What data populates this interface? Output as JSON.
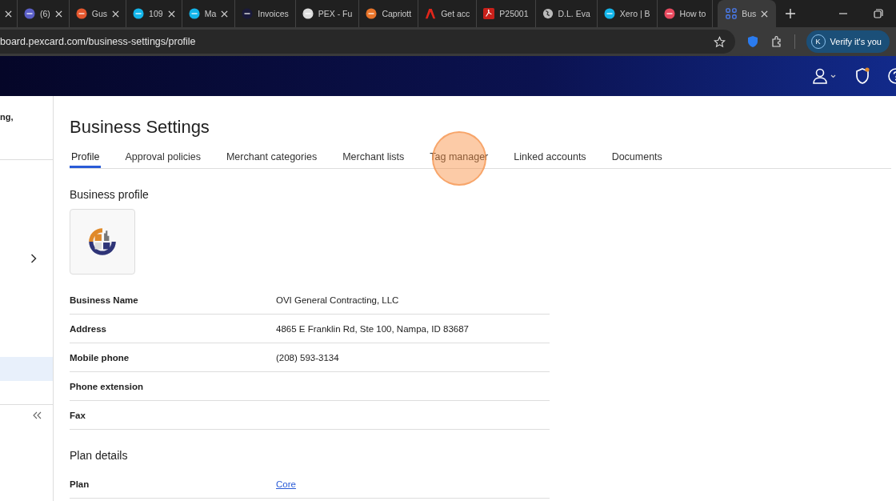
{
  "browser": {
    "tabs": [
      {
        "selected": false
      },
      {
        "title": "(6)",
        "selected": false
      },
      {
        "title": "Gus",
        "selected": false
      },
      {
        "title": "109",
        "selected": false
      },
      {
        "title": "Ma",
        "selected": false
      },
      {
        "title": "Invoices",
        "selected": false
      },
      {
        "title": "PEX - Fu",
        "selected": false
      },
      {
        "title": "Capriott",
        "selected": false
      },
      {
        "title": "Get acc",
        "selected": false
      },
      {
        "title": "P25001",
        "selected": false
      },
      {
        "title": "D.L. Eva",
        "selected": false
      },
      {
        "title": "Xero | B",
        "selected": false
      },
      {
        "title": "How to",
        "selected": false
      },
      {
        "title": "Bus",
        "selected": true
      }
    ],
    "url": "board.pexcard.com/business-settings/profile",
    "profile_button": {
      "initial": "K",
      "label": "Verify it's you"
    }
  },
  "sidebar": {
    "text": "ng,",
    "selected_row": true
  },
  "page": {
    "title": "Business Settings",
    "tabs": [
      {
        "label": "Profile",
        "selected": true,
        "highlighted": false
      },
      {
        "label": "Approval policies",
        "selected": false,
        "highlighted": false
      },
      {
        "label": "Merchant categories",
        "selected": false,
        "highlighted": false
      },
      {
        "label": "Merchant lists",
        "selected": false,
        "highlighted": false
      },
      {
        "label": "Tag manager",
        "selected": false,
        "highlighted": true
      },
      {
        "label": "Linked accounts",
        "selected": false,
        "highlighted": false
      },
      {
        "label": "Documents",
        "selected": false,
        "highlighted": false
      }
    ],
    "sections": [
      {
        "heading": "Business profile",
        "logo": true,
        "rows": [
          {
            "label": "Business Name",
            "value": "OVI General Contracting, LLC",
            "kind": "text"
          },
          {
            "label": "Address",
            "value": "4865 E Franklin Rd, Ste 100, Nampa, ID 83687",
            "kind": "text"
          },
          {
            "label": "Mobile phone",
            "value": "(208) 593-3134",
            "kind": "text"
          },
          {
            "label": "Phone extension",
            "kind": "text"
          },
          {
            "label": "Fax",
            "kind": "text"
          }
        ]
      },
      {
        "heading": "Plan details",
        "logo": false,
        "rows": [
          {
            "label": "Plan",
            "value": "Core",
            "kind": "link"
          }
        ]
      }
    ]
  }
}
